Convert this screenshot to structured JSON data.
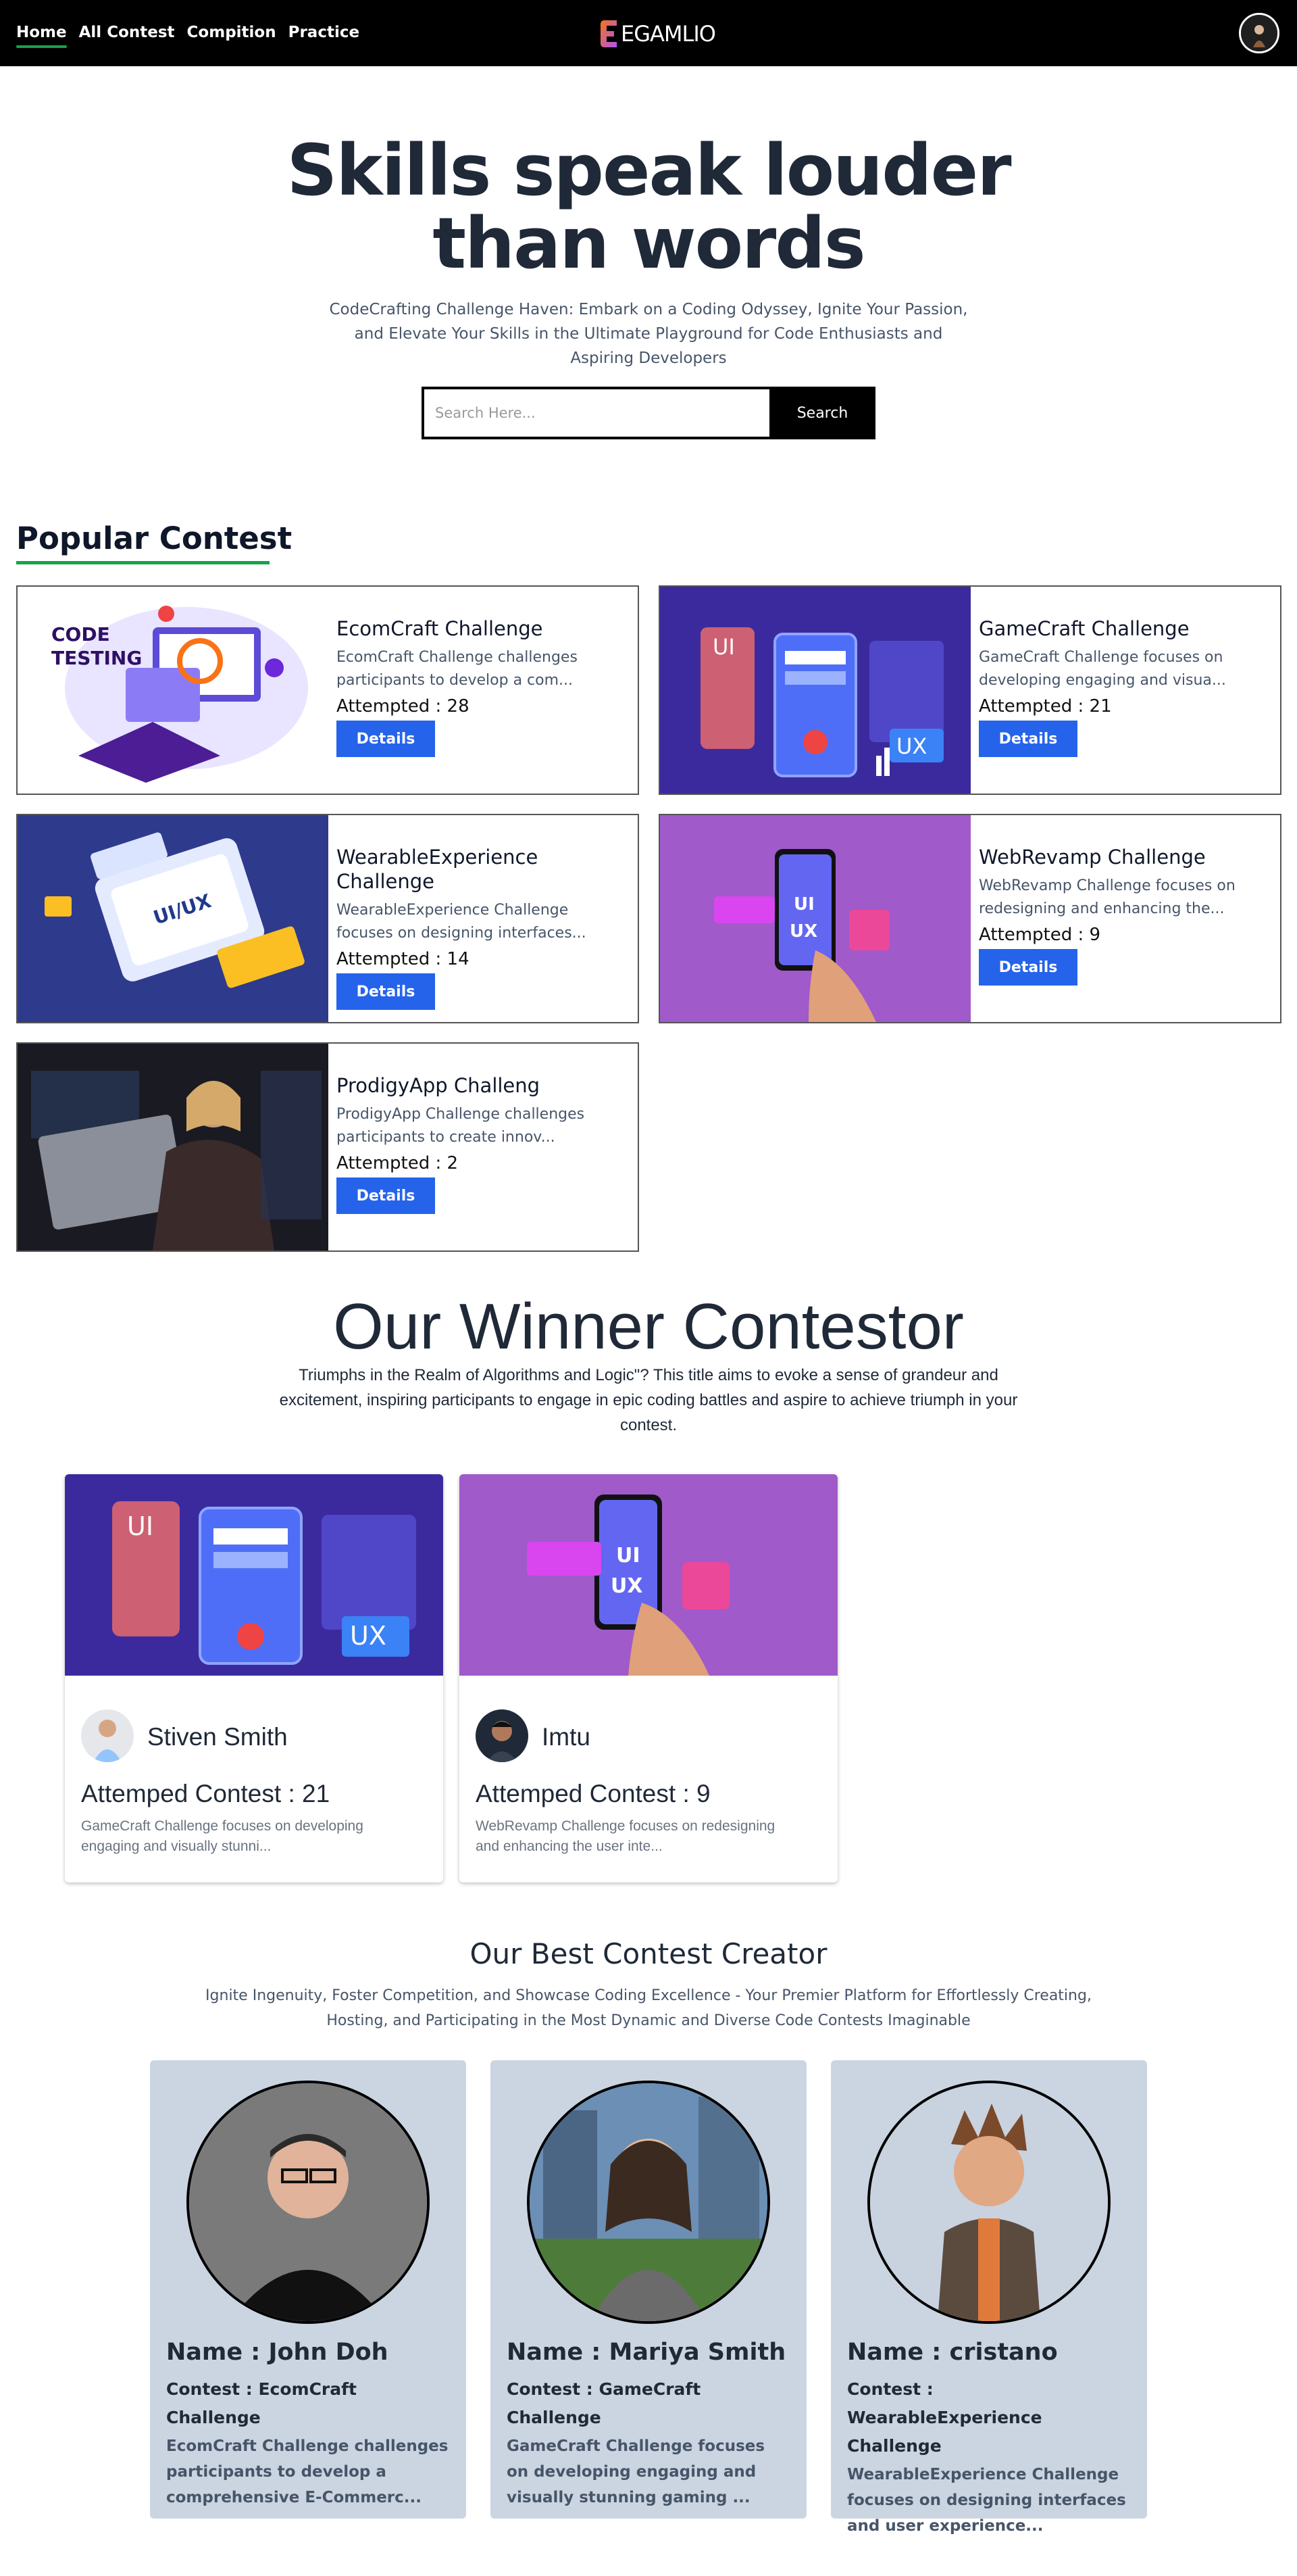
{
  "nav": {
    "links": [
      "Home",
      "All Contest",
      "Compition",
      "Practice"
    ],
    "logo_text": "EGAMLIO"
  },
  "hero": {
    "title_line1": "Skills speak louder",
    "title_line2": "than words",
    "subtitle": "CodeCrafting Challenge Haven: Embark on a Coding Odyssey, Ignite Your Passion, and Elevate Your Skills in the Ultimate Playground for Code Enthusiasts and Aspiring Developers",
    "search_placeholder": "Search Here...",
    "search_button": "Search"
  },
  "popular": {
    "title": "Popular Contest",
    "details_label": "Details",
    "cards": [
      {
        "title": "EcomCraft Challenge",
        "desc": "EcomCraft Challenge challenges participants to develop a com...",
        "attempted": "Attempted : 28"
      },
      {
        "title": "GameCraft Challenge",
        "desc": "GameCraft Challenge focuses on developing engaging and visua...",
        "attempted": "Attempted : 21"
      },
      {
        "title": "WearableExperience Challenge",
        "desc": "WearableExperience Challenge focuses on designing interfaces...",
        "attempted": "Attempted : 14"
      },
      {
        "title": "WebRevamp Challenge",
        "desc": "WebRevamp Challenge focuses on redesigning and enhancing the...",
        "attempted": "Attempted : 9"
      },
      {
        "title": "ProdigyApp Challeng",
        "desc": "ProdigyApp Challenge challenges participants to create innov...",
        "attempted": "Attempted : 2"
      }
    ]
  },
  "winners": {
    "title": "Our Winner Contestor",
    "subtitle": "Triumphs in the Realm of Algorithms and Logic\"? This title aims to evoke a sense of grandeur and excitement, inspiring participants to engage in epic coding battles and aspire to achieve triumph in your contest.",
    "cards": [
      {
        "name": "Stiven Smith",
        "attempted": "Attemped Contest : 21",
        "desc": "GameCraft Challenge focuses on developing engaging and visually stunni..."
      },
      {
        "name": "Imtu",
        "attempted": "Attemped Contest : 9",
        "desc": "WebRevamp Challenge focuses on redesigning and enhancing the user inte..."
      }
    ]
  },
  "creators": {
    "title": "Our Best Contest Creator",
    "subtitle": "Ignite Ingenuity, Foster Competition, and Showcase Coding Excellence - Your Premier Platform for Effortlessly Creating, Hosting, and Participating in the Most Dynamic and Diverse Code Contests Imaginable",
    "cards": [
      {
        "name": "Name : John Doh",
        "contest": "Contest : EcomCraft Challenge",
        "desc": "EcomCraft Challenge challenges participants to develop a comprehensive E-Commerc..."
      },
      {
        "name": "Name : Mariya Smith",
        "contest": "Contest : GameCraft Challenge",
        "desc": "GameCraft Challenge focuses on developing engaging and visually stunning gaming ..."
      },
      {
        "name": "Name : cristano",
        "contest": "Contest : WearableExperience Challenge",
        "desc": "WearableExperience Challenge focuses on designing interfaces and user experience..."
      }
    ]
  },
  "colors": {
    "accent": "#2563eb",
    "underline": "#16a34a",
    "card_bg": "#cbd5e1"
  }
}
